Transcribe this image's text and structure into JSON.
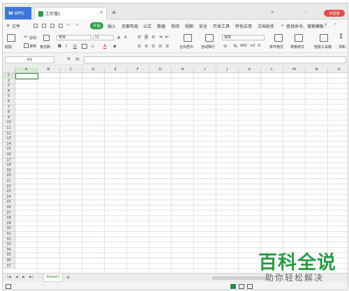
{
  "titlebar": {
    "app_tab": "WPS",
    "app_logo": "W",
    "doc_tab": "工作簿1",
    "close_glyph": "×",
    "add_glyph": "+",
    "login_button": "未登录"
  },
  "menu": {
    "file": "文件",
    "items": [
      "开始",
      "插入",
      "页面布局",
      "公式",
      "数据",
      "审阅",
      "视图",
      "安全",
      "开发工具",
      "特色应用",
      "文档助手"
    ],
    "search": "查找命令、搜索模板",
    "help": "?"
  },
  "ribbon": {
    "cut": "剪切",
    "copy": "复制",
    "paste": "粘贴",
    "format_painter": "格式刷",
    "font_name": "宋体",
    "font_size": "11",
    "bold": "B",
    "italic": "I",
    "underline": "U",
    "font_color": "A",
    "merge_center": "合并居中",
    "wrap_text": "自动换行",
    "number_format": "常规",
    "conditional_format": "条件格式",
    "table_style": "表格样式",
    "smart_tools": "智能工具箱",
    "sum": "求和"
  },
  "formula_bar": {
    "cell_ref": "A1",
    "fx": "fx",
    "zoom_glyph": "⊕"
  },
  "grid": {
    "columns": [
      "A",
      "B",
      "C",
      "D",
      "E",
      "F",
      "G",
      "H",
      "I",
      "J",
      "K",
      "L",
      "M",
      "N",
      "O"
    ],
    "rows": [
      "1",
      "2",
      "3",
      "4",
      "5",
      "6",
      "7",
      "8",
      "9",
      "10",
      "11",
      "12",
      "13",
      "14",
      "15",
      "16",
      "17",
      "18",
      "19",
      "20",
      "21",
      "22",
      "23",
      "24",
      "25",
      "26",
      "27",
      "28",
      "29",
      "30",
      "31",
      "32",
      "33",
      "34",
      "35",
      "36",
      "37"
    ],
    "selected_column": "A",
    "selected_row": "1"
  },
  "sheets": {
    "tabs": [
      "Sheet1"
    ],
    "add": "+",
    "nav": [
      "|◀",
      "◀",
      "▶",
      "▶|"
    ]
  },
  "watermark": {
    "main": "百科全说",
    "sub": "助你轻松解决"
  },
  "colors": {
    "accent_green": "#2d9b4a",
    "wps_blue": "#3d78d8",
    "login_red": "#e84a4a"
  }
}
